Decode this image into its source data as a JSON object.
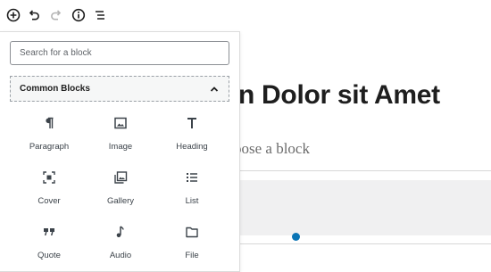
{
  "toolbar": {
    "buttons": [
      {
        "name": "add-block-button",
        "icon": "plus-circle-icon"
      },
      {
        "name": "undo-button",
        "icon": "undo-icon"
      },
      {
        "name": "redo-button",
        "icon": "redo-icon"
      },
      {
        "name": "info-button",
        "icon": "info-icon"
      },
      {
        "name": "outline-button",
        "icon": "list-view-icon"
      }
    ]
  },
  "inserter": {
    "search_placeholder": "Search for a block",
    "section_title": "Common Blocks",
    "blocks": [
      {
        "label": "Paragraph",
        "icon": "paragraph-icon"
      },
      {
        "label": "Image",
        "icon": "image-icon"
      },
      {
        "label": "Heading",
        "icon": "heading-icon"
      },
      {
        "label": "Cover",
        "icon": "cover-icon"
      },
      {
        "label": "Gallery",
        "icon": "gallery-icon"
      },
      {
        "label": "List",
        "icon": "list-icon"
      },
      {
        "label": "Quote",
        "icon": "quote-icon"
      },
      {
        "label": "Audio",
        "icon": "audio-icon"
      },
      {
        "label": "File",
        "icon": "file-icon"
      }
    ]
  },
  "editor": {
    "title_fragment": "n Dolor sit Amet",
    "placeholder_fragment": "oose a block"
  },
  "colors": {
    "accent": "#0a74b5",
    "text": "#1e1e1e",
    "border": "#8c8f94"
  }
}
